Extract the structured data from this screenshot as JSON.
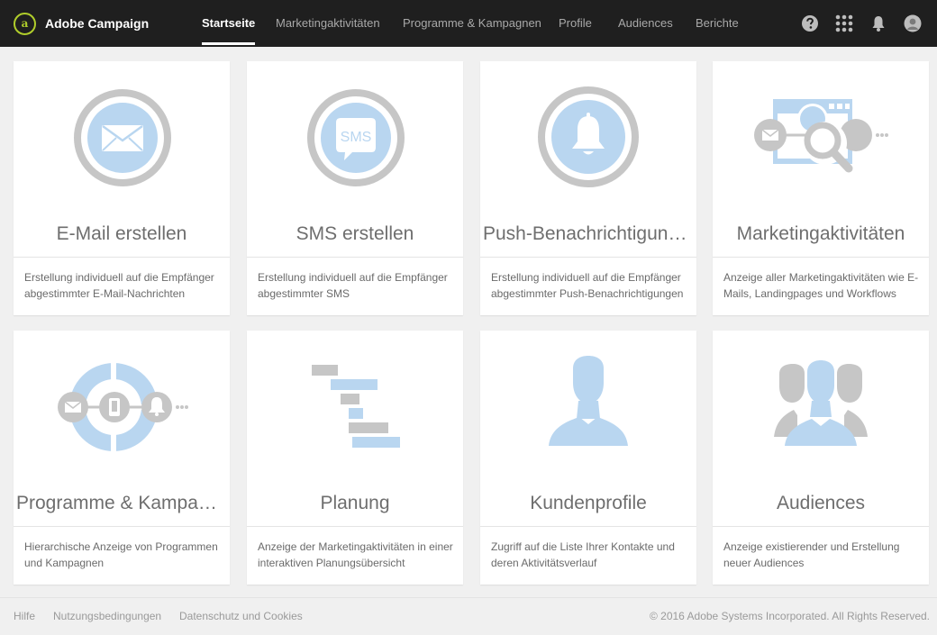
{
  "app": {
    "name": "Adobe Campaign"
  },
  "nav": [
    "Startseite",
    "Marketingaktivitäten",
    "Programme & Kampagnen",
    "Profile",
    "Audiences",
    "Berichte"
  ],
  "topbar_icons": [
    "help-icon",
    "apps-grid-icon",
    "notification-bell-icon",
    "user-avatar-icon"
  ],
  "cards": [
    {
      "title": "E-Mail erstellen",
      "description": "Erstellung individuell auf die Empfänger abgestimmter E-Mail-Nachrichten",
      "icon": "email-icon"
    },
    {
      "title": "SMS erstellen",
      "description": "Erstellung individuell auf die Empfänger abgestimmter SMS",
      "icon": "sms-icon",
      "icon_text": "SMS"
    },
    {
      "title": "Push-Benachrichtigung er…",
      "description": "Erstellung individuell auf die Empfänger abgestimmter Push-Benachrichtigungen",
      "icon": "push-bell-icon"
    },
    {
      "title": "Marketingaktivitäten",
      "description": "Anzeige aller Marketingaktivitäten wie E-Mails, Landingpages und Workflows",
      "icon": "marketing-activities-icon"
    },
    {
      "title": "Programme & Kampagnen",
      "description": "Hierarchische Anzeige von Programmen und Kampagnen",
      "icon": "programs-campaigns-icon"
    },
    {
      "title": "Planung",
      "description": "Anzeige der Marketingaktivitäten in einer interaktiven Planungsübersicht",
      "icon": "planning-gantt-icon"
    },
    {
      "title": "Kundenprofile",
      "description": "Zugriff auf die Liste Ihrer Kontakte und deren Aktivitätsverlauf",
      "icon": "customer-profile-icon"
    },
    {
      "title": "Audiences",
      "description": "Anzeige existierender und Erstellung neuer Audiences",
      "icon": "audiences-icon"
    }
  ],
  "footer": {
    "links": [
      "Hilfe",
      "Nutzungsbedingungen",
      "Datenschutz und Cookies"
    ],
    "copyright": "© 2016 Adobe Systems Incorporated. All Rights Reserved."
  },
  "colors": {
    "topbar": "#1f1f1f",
    "brand_accent": "#b0cd2b",
    "icon_blue": "#b9d6f0",
    "icon_gray": "#c6c6c6"
  }
}
